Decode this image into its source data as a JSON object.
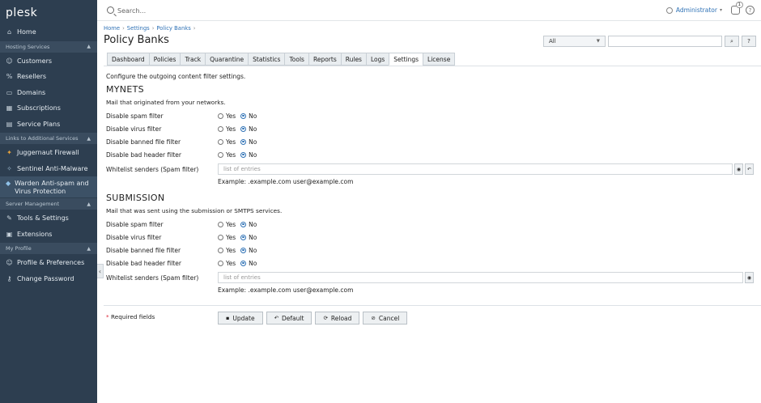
{
  "app": {
    "logo": "plesk"
  },
  "sidebar": {
    "home": "Home",
    "sections": [
      {
        "title": "Hosting Services",
        "items": [
          "Customers",
          "Resellers",
          "Domains",
          "Subscriptions",
          "Service Plans"
        ]
      },
      {
        "title": "Links to Additional Services",
        "items": [
          "Juggernaut Firewall",
          "Sentinel Anti-Malware",
          "Warden Anti-spam and Virus Protection"
        ]
      },
      {
        "title": "Server Management",
        "items": [
          "Tools & Settings",
          "Extensions"
        ]
      },
      {
        "title": "My Profile",
        "items": [
          "Profile & Preferences",
          "Change Password"
        ]
      }
    ]
  },
  "topbar": {
    "search_placeholder": "Search...",
    "user": "Administrator",
    "notifications_count": "1",
    "help": "?"
  },
  "breadcrumb": [
    "Home",
    "Settings",
    "Policy Banks"
  ],
  "page_title": "Policy Banks",
  "filter": {
    "select_value": "All",
    "search_button": "⌕",
    "help_button": "?"
  },
  "tabs": [
    "Dashboard",
    "Policies",
    "Track",
    "Quarantine",
    "Statistics",
    "Tools",
    "Reports",
    "Rules",
    "Logs",
    "Settings",
    "License"
  ],
  "active_tab": "Settings",
  "intro": "Configure the outgoing content filter settings.",
  "mynets": {
    "title": "MYNETS",
    "description": "Mail that originated from your networks.",
    "rows": [
      {
        "label": "Disable spam filter",
        "yes": "Yes",
        "no": "No",
        "selected": "no"
      },
      {
        "label": "Disable virus filter",
        "yes": "Yes",
        "no": "No",
        "selected": "no"
      },
      {
        "label": "Disable banned file filter",
        "yes": "Yes",
        "no": "No",
        "selected": "no"
      },
      {
        "label": "Disable bad header filter",
        "yes": "Yes",
        "no": "No",
        "selected": "no"
      }
    ],
    "whitelist_label": "Whitelist senders (Spam filter)",
    "whitelist_placeholder": "list of entries",
    "example": "Example: .example.com user@example.com"
  },
  "submission": {
    "title": "SUBMISSION",
    "description": "Mail that was sent using the submission or SMTPS services.",
    "rows": [
      {
        "label": "Disable spam filter",
        "yes": "Yes",
        "no": "No",
        "selected": "no"
      },
      {
        "label": "Disable virus filter",
        "yes": "Yes",
        "no": "No",
        "selected": "no"
      },
      {
        "label": "Disable banned file filter",
        "yes": "Yes",
        "no": "No",
        "selected": "no"
      },
      {
        "label": "Disable bad header filter",
        "yes": "Yes",
        "no": "No",
        "selected": "no"
      }
    ],
    "whitelist_label": "Whitelist senders (Spam filter)",
    "whitelist_placeholder": "list of entries",
    "example": "Example: .example.com user@example.com"
  },
  "footer": {
    "required_star": "*",
    "required_text": "Required fields",
    "buttons": [
      "Update",
      "Default",
      "Reload",
      "Cancel"
    ]
  }
}
